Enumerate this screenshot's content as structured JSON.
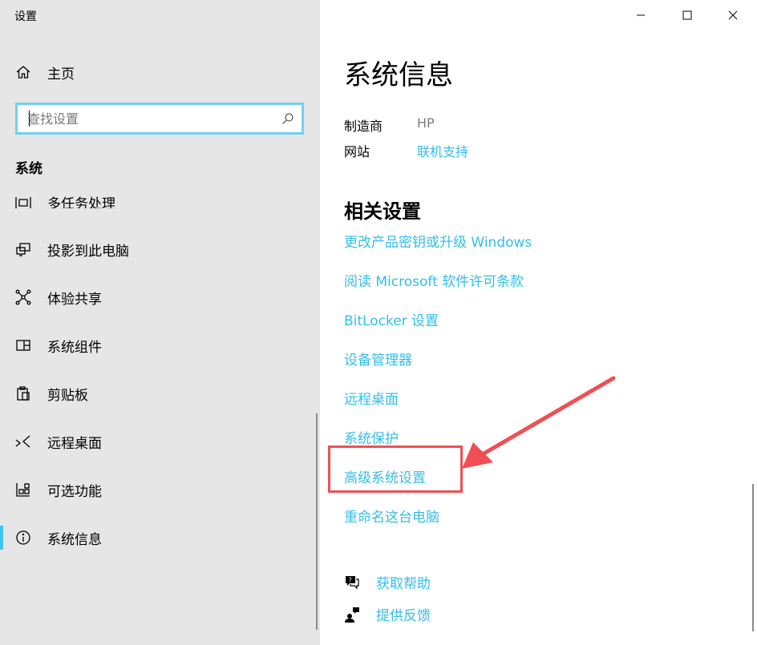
{
  "window": {
    "title": "设置"
  },
  "sidebar": {
    "home_label": "主页",
    "search_placeholder": "查找设置",
    "section_title": "系统",
    "items": [
      {
        "label": "多任务处理",
        "icon": "multitask-icon",
        "partial": true
      },
      {
        "label": "投影到此电脑",
        "icon": "project-icon"
      },
      {
        "label": "体验共享",
        "icon": "share-icon"
      },
      {
        "label": "系统组件",
        "icon": "components-icon"
      },
      {
        "label": "剪贴板",
        "icon": "clipboard-icon"
      },
      {
        "label": "远程桌面",
        "icon": "remote-desktop-icon"
      },
      {
        "label": "可选功能",
        "icon": "optional-features-icon"
      },
      {
        "label": "系统信息",
        "icon": "info-icon",
        "active": true
      }
    ]
  },
  "main": {
    "title": "系统信息",
    "manufacturer_label": "制造商",
    "manufacturer_value": "HP",
    "website_label": "网站",
    "website_value": "联机支持",
    "related_title": "相关设置",
    "related_links": [
      "更改产品密钥或升级 Windows",
      "阅读 Microsoft 软件许可条款",
      "BitLocker 设置",
      "设备管理器",
      "远程桌面",
      "系统保护",
      "高级系统设置",
      "重命名这台电脑"
    ],
    "help_label": "获取帮助",
    "feedback_label": "提供反馈"
  },
  "colors": {
    "accent": "#36bde8",
    "sidebar_bg": "#e6e6e6",
    "annotation": "#ef4f55"
  }
}
